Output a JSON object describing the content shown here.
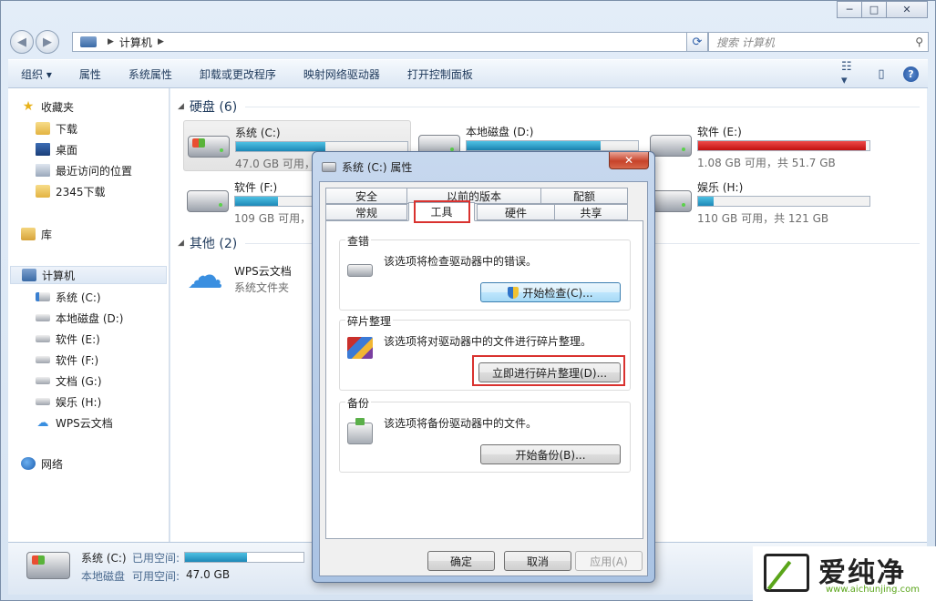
{
  "window": {
    "buttons": {
      "minimize": "─",
      "maximize": "□",
      "close": "✕"
    }
  },
  "address": {
    "path": "计算机",
    "search_placeholder": "搜索 计算机"
  },
  "toolbar": {
    "items": [
      "组织 ▾",
      "属性",
      "系统属性",
      "卸载或更改程序",
      "映射网络驱动器",
      "打开控制面板"
    ]
  },
  "nav": {
    "favorites": "收藏夹",
    "downloads": "下载",
    "desktop": "桌面",
    "recent": "最近访问的位置",
    "dl2345": "2345下载",
    "library": "库",
    "computer": "计算机",
    "drives": [
      "系统 (C:)",
      "本地磁盘 (D:)",
      "软件 (E:)",
      "软件 (F:)",
      "文档 (G:)",
      "娱乐 (H:)",
      "WPS云文档"
    ],
    "network": "网络"
  },
  "content": {
    "group_hdd": "硬盘 (6)",
    "group_other": "其他 (2)",
    "drives": [
      {
        "name": "系统 (C:)",
        "info": "47.0 GB 可用，",
        "used_fraction": 0.52
      },
      {
        "name": "本地磁盘 (D:)",
        "info": "",
        "used_fraction": 0.78
      },
      {
        "name": "软件 (E:)",
        "info": "1.08 GB 可用，共 51.7 GB",
        "used_fraction": 0.98
      },
      {
        "name": "软件 (F:)",
        "info": "109 GB 可用，",
        "used_fraction": 0.25
      },
      {
        "name": "娱乐 (H:)",
        "info": "110 GB 可用，共 121 GB",
        "used_fraction": 0.09
      }
    ],
    "wps": {
      "name": "WPS云文档",
      "sub": "系统文件夹"
    }
  },
  "details": {
    "name": "系统 (C:)",
    "used_label": "已用空间:",
    "type": "本地磁盘",
    "free_label": "可用空间:",
    "free_value": "47.0 GB",
    "used_fraction": 0.52
  },
  "dialog": {
    "title": "系统 (C:) 属性",
    "close": "✕",
    "tabs_top": [
      "安全",
      "以前的版本",
      "配额"
    ],
    "tabs_bottom": [
      "常规",
      "工具",
      "硬件",
      "共享"
    ],
    "active_tab": "工具",
    "check": {
      "title": "查错",
      "desc": "该选项将检查驱动器中的错误。",
      "button": "开始检查(C)..."
    },
    "defrag": {
      "title": "碎片整理",
      "desc": "该选项将对驱动器中的文件进行碎片整理。",
      "button": "立即进行碎片整理(D)..."
    },
    "backup": {
      "title": "备份",
      "desc": "该选项将备份驱动器中的文件。",
      "button": "开始备份(B)..."
    },
    "ok": "确定",
    "cancel": "取消",
    "apply": "应用(A)"
  },
  "watermark": {
    "text": "爱纯净",
    "url": "www.aichunjing.com"
  },
  "colors": {
    "highlight": "#d9322f",
    "bar_fill": "#1d88b7",
    "bar_full": "#c21010"
  }
}
